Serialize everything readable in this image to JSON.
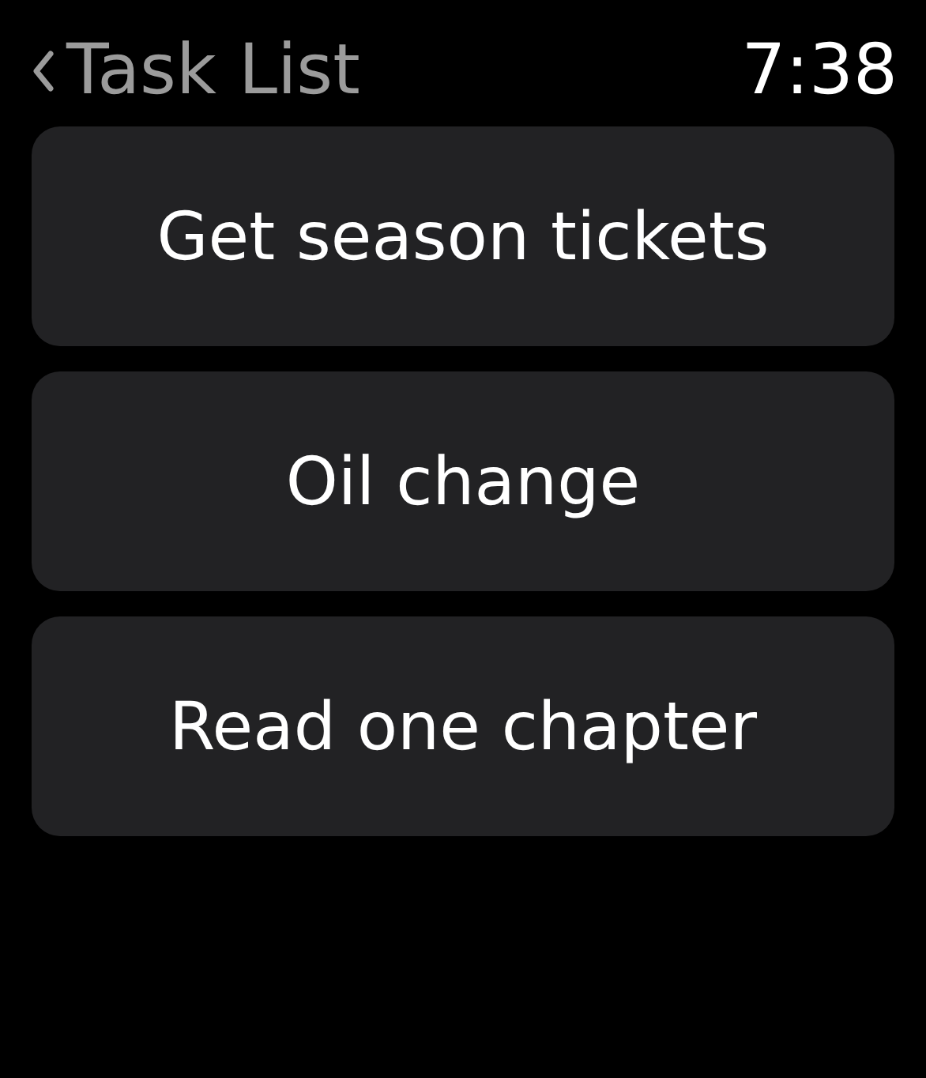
{
  "header": {
    "back_title": "Task List",
    "time": "7:38"
  },
  "tasks": [
    {
      "label": "Get season tickets"
    },
    {
      "label": "Oil change"
    },
    {
      "label": "Read one chapter"
    }
  ]
}
